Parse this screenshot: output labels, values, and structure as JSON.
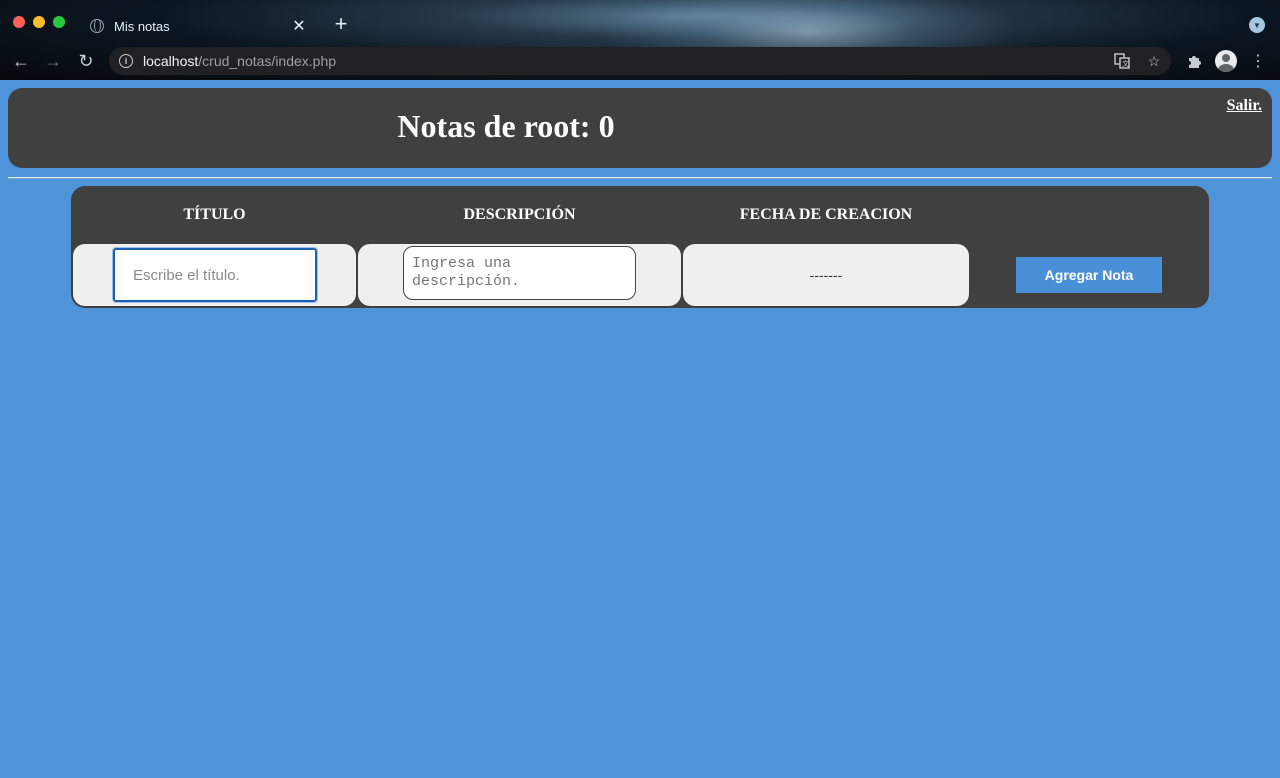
{
  "browser": {
    "tab_title": "Mis notas",
    "tab_close": "✕",
    "new_tab": "+",
    "url_host": "localhost",
    "url_path": "/crud_notas/index.php"
  },
  "header": {
    "title": "Notas de root: 0",
    "logout_label": "Salir."
  },
  "table": {
    "columns": [
      "TÍTULO",
      "DESCRIPCIÓN",
      "FECHA DE CREACION"
    ],
    "title_placeholder": "Escribe el título.",
    "description_placeholder": "Ingresa una descripción.",
    "date_value": "-------",
    "add_button_label": "Agregar Nota"
  },
  "colors": {
    "page_background": "#4f93d8",
    "panel_background": "#404040",
    "cell_background": "#efefef",
    "button_background": "#4a90d9"
  },
  "icons": [
    "globe-icon",
    "close-icon",
    "plus-icon",
    "back-arrow-icon",
    "forward-arrow-icon",
    "reload-icon",
    "info-icon",
    "translate-icon",
    "star-icon",
    "puzzle-icon",
    "avatar-icon",
    "kebab-menu-icon",
    "profile-menu-icon"
  ]
}
